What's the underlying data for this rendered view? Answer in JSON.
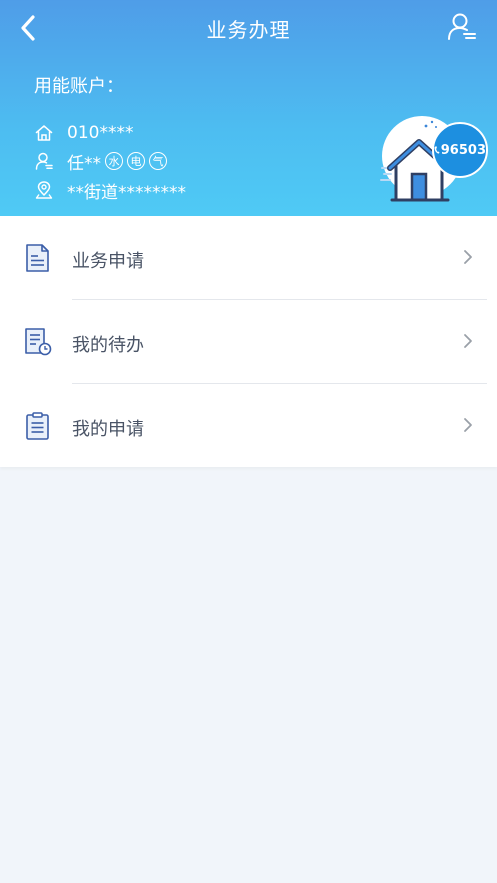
{
  "nav": {
    "title": "业务办理"
  },
  "account": {
    "label": "用能账户：",
    "number": "010****",
    "name": "任**",
    "badges": [
      "水",
      "电",
      "气"
    ],
    "address": "**街道********"
  },
  "hotline": {
    "number": "96503"
  },
  "menu": {
    "items": [
      {
        "label": "业务申请"
      },
      {
        "label": "我的待办"
      },
      {
        "label": "我的申请"
      }
    ]
  },
  "colors": {
    "header_top": "#4f9de8",
    "header_bottom": "#4fcaf5",
    "hotline": "#1d8fe0",
    "menu_text": "#4a5466",
    "icon_blue": "#3b5ea8",
    "background": "#f1f5fa"
  }
}
